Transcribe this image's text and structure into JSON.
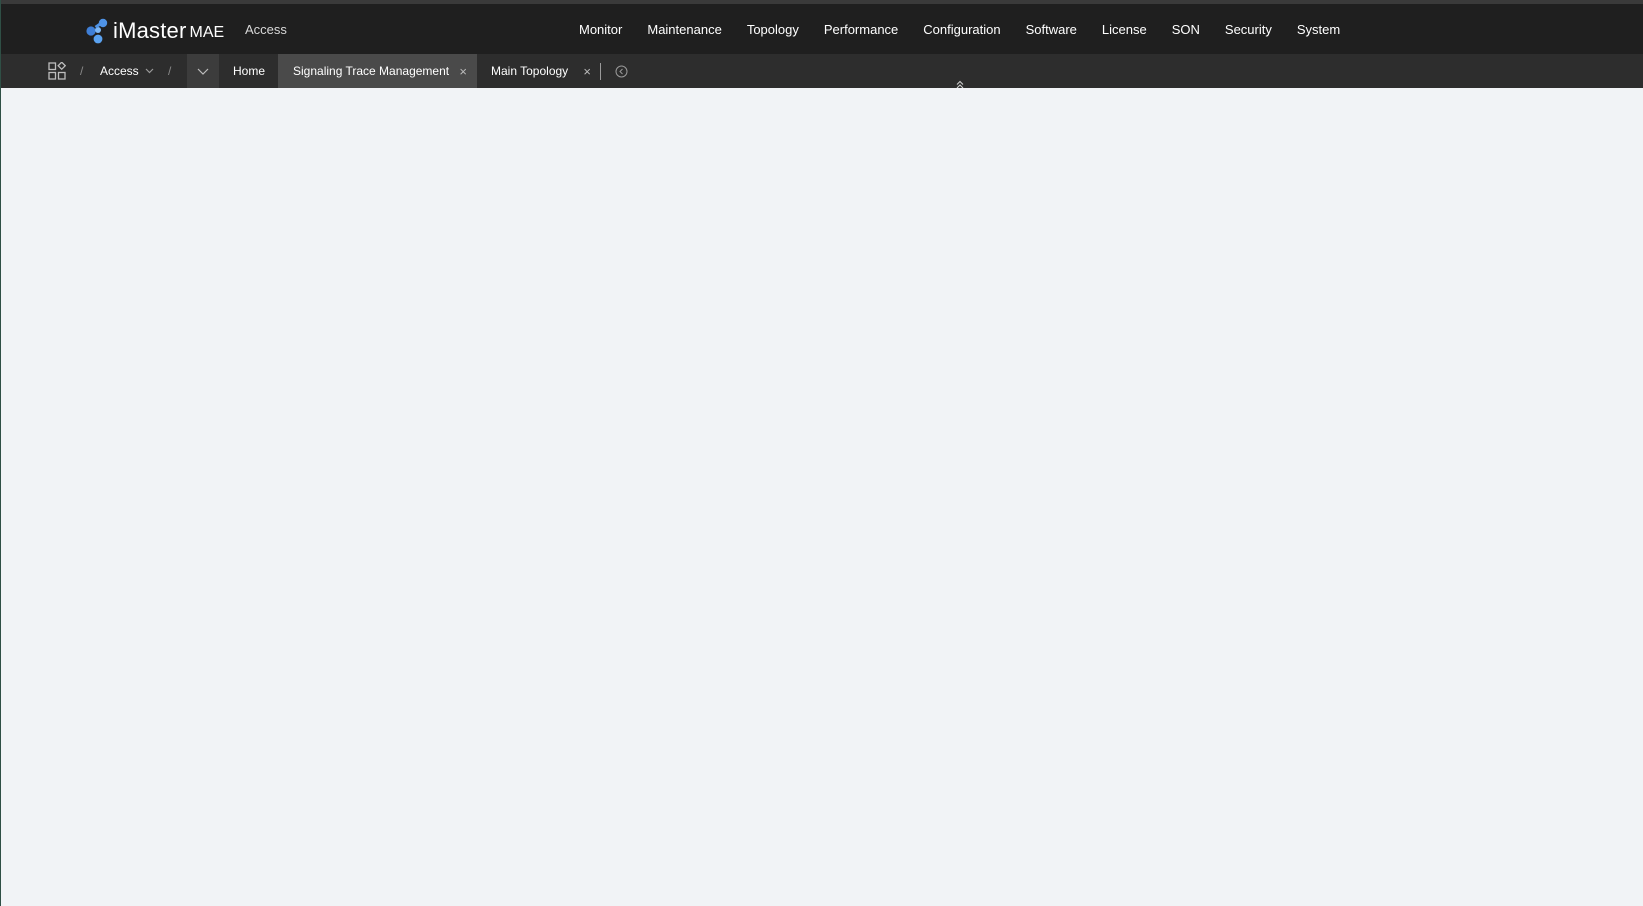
{
  "header": {
    "brand": "iMaster",
    "brand_suffix": "MAE",
    "subtitle": "Access",
    "nav": [
      "Monitor",
      "Maintenance",
      "Topology",
      "Performance",
      "Configuration",
      "Software",
      "License",
      "SON",
      "Security",
      "System"
    ]
  },
  "tabbar": {
    "breadcrumb_access": "Access",
    "separator": "/",
    "tabs": [
      {
        "label": "Home"
      },
      {
        "label": "Signaling Trace Management",
        "active": true
      },
      {
        "label": "Main Topology"
      }
    ],
    "close_symbol": "×"
  },
  "icons": {
    "logo": "imaster-logo-icon",
    "apps": "grid-apps-icon",
    "chevron": "chevron-down-icon",
    "close": "close-icon",
    "more": "circle-more-icon",
    "collapse": "double-chevron-up-icon"
  },
  "colors": {
    "topbar": "#1f1f1f",
    "tabbar": "#2d2d2d",
    "active_tab": "#4a4a4a",
    "content_bg": "#f1f3f6",
    "logo_blue": "#4f93e6"
  }
}
